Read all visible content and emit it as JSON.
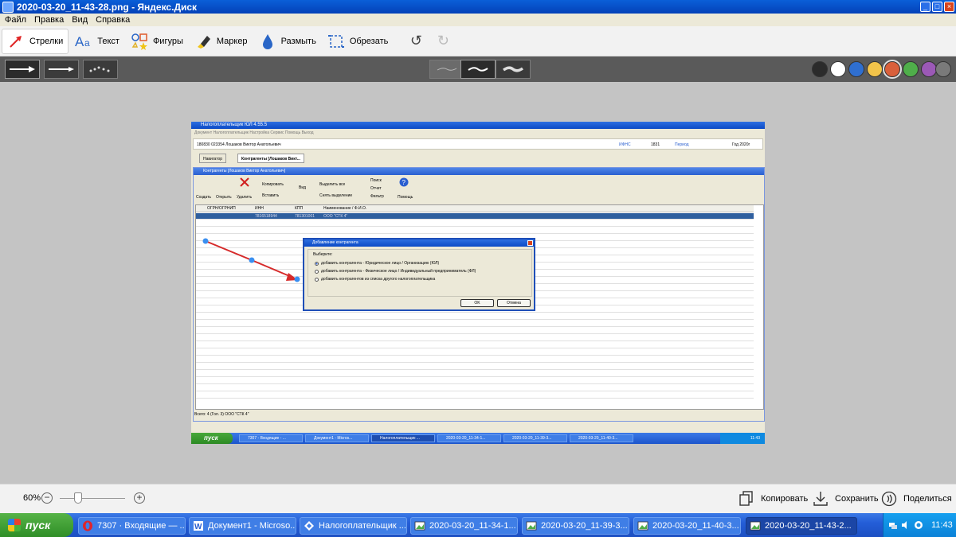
{
  "window": {
    "title": "2020-03-20_11-43-28.png - Яндекс.Диск",
    "min": "_",
    "max": "□",
    "close": "×"
  },
  "menu": [
    "Файл",
    "Правка",
    "Вид",
    "Справка"
  ],
  "toolbar": {
    "tools": [
      {
        "label": "Стрелки",
        "icon": "arrow-icon"
      },
      {
        "label": "Текст",
        "icon": "text-icon"
      },
      {
        "label": "Фигуры",
        "icon": "shapes-icon"
      },
      {
        "label": "Маркер",
        "icon": "marker-icon"
      },
      {
        "label": "Размыть",
        "icon": "blur-icon"
      },
      {
        "label": "Обрезать",
        "icon": "crop-icon"
      }
    ],
    "undo": "↺",
    "redo": "↻"
  },
  "colors": [
    "#2b2b2b",
    "#ffffff",
    "#2f6fd0",
    "#f3c44a",
    "#d9603b",
    "#4fae4a",
    "#9b59b6",
    "#7a7a7a"
  ],
  "selected_color": "#d9603b",
  "screenshot": {
    "title": "Налогоплательщик ЮЛ 4.55.5",
    "menu": "Документ   Налогоплательщик   Настройка   Сервис   Помощь   Выход",
    "info": {
      "name": "180830 023354 Лошаков Виктор Анатольевич",
      "ifns_label": "ИФНС",
      "ifns": "1831",
      "period_label": "Период",
      "year": "Год 2020г"
    },
    "tabs": [
      "Навигатор",
      "Контрагенты [Лошаков Викт..."
    ],
    "child_title": "Контрагенты [Лошаков Виктор Анатольевич]",
    "tools": {
      "create": "Создать",
      "open": "Открыть",
      "delete": "Удалить",
      "copy": "Копировать",
      "paste": "Вставить",
      "view": "Вид",
      "select_all": "Выделить все",
      "clear_sel": "Снять выделение",
      "search": "Поиск",
      "report": "Отчет",
      "filter": "Фильтр",
      "help": "Помощь"
    },
    "columns": [
      "ОГРН/ОГРНИП",
      "ИНН",
      "КПП",
      "Наименование / Ф.И.О."
    ],
    "rows": [
      [
        "",
        "7816518944",
        "781301001",
        "ООО \"СТК 4\""
      ]
    ],
    "status": "Всего: 4 (Гол. 3)   ООО \"СТК 4\"",
    "dialog": {
      "title": "Добавление контрагента",
      "prompt": "Выберите:",
      "options": [
        "добавить контрагента - Юридическое лицо / Организацию (ЮЛ)",
        "добавить контрагента - Физическое лицо / Индивидуальный предприниматель (ФЛ)",
        "добавить контрагентов из списка другого налогоплательщика"
      ],
      "ok": "OK",
      "cancel": "Отмена"
    },
    "taskbar": {
      "start": "пуск",
      "items": [
        "7307 - Входящие - ...",
        "Документ1 - Micros...",
        "Налогоплательщик ...",
        "2020-03-20_11-34-1...",
        "2020-03-20_11-39-3...",
        "2020-03-20_11-40-3..."
      ],
      "clock": "11:43"
    }
  },
  "bottom": {
    "zoom": "60%",
    "zoom_minus": "−",
    "zoom_plus": "+",
    "copy": "Копировать",
    "save": "Сохранить",
    "share": "Поделиться"
  },
  "taskbar": {
    "start": "пуск",
    "items": [
      {
        "label": "7307 · Входящие — ...",
        "icon": "opera-icon"
      },
      {
        "label": "Документ1 - Microso...",
        "icon": "word-icon"
      },
      {
        "label": "Налогоплательщик ...",
        "icon": "taxpayer-icon"
      },
      {
        "label": "2020-03-20_11-34-1...",
        "icon": "image-icon"
      },
      {
        "label": "2020-03-20_11-39-3...",
        "icon": "image-icon"
      },
      {
        "label": "2020-03-20_11-40-3...",
        "icon": "image-icon"
      },
      {
        "label": "2020-03-20_11-43-2...",
        "icon": "image-icon"
      }
    ],
    "clock": "11:43"
  }
}
